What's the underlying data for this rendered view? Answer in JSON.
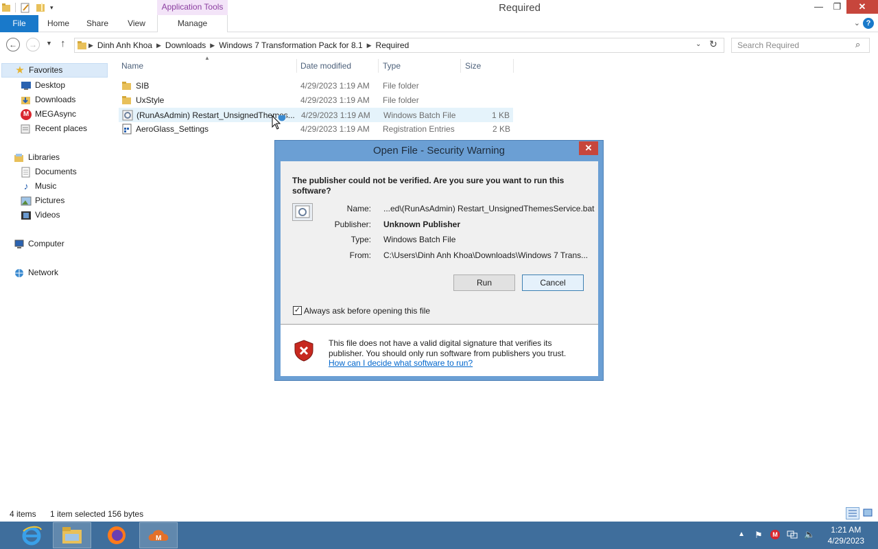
{
  "window": {
    "title": "Required",
    "contextual_tab_group": "Application Tools",
    "minimize": "—",
    "restore": "❐",
    "close": "✕"
  },
  "ribbon": {
    "tabs": [
      "File",
      "Home",
      "Share",
      "View",
      "Manage"
    ]
  },
  "address": {
    "crumbs": [
      "Dinh  Anh Khoa",
      "Downloads",
      "Windows 7 Transformation Pack for 8.1",
      "Required"
    ],
    "search_placeholder": "Search Required"
  },
  "nav": {
    "favorites_label": "Favorites",
    "favorites": [
      "Desktop",
      "Downloads",
      "MEGAsync",
      "Recent places"
    ],
    "libraries_label": "Libraries",
    "libraries": [
      "Documents",
      "Music",
      "Pictures",
      "Videos"
    ],
    "computer": "Computer",
    "network": "Network"
  },
  "columns": {
    "name": "Name",
    "date": "Date modified",
    "type": "Type",
    "size": "Size"
  },
  "files": [
    {
      "name": "SIB",
      "date": "4/29/2023 1:19 AM",
      "type": "File folder",
      "size": "",
      "icon": "folder-icon"
    },
    {
      "name": "UxStyle",
      "date": "4/29/2023 1:19 AM",
      "type": "File folder",
      "size": "",
      "icon": "folder-icon"
    },
    {
      "name": "(RunAsAdmin) Restart_UnsignedThemes...",
      "date": "4/29/2023 1:19 AM",
      "type": "Windows Batch File",
      "size": "1 KB",
      "icon": "batch-file-icon"
    },
    {
      "name": "AeroGlass_Settings",
      "date": "4/29/2023 1:19 AM",
      "type": "Registration Entries",
      "size": "2 KB",
      "icon": "registry-file-icon"
    }
  ],
  "status": {
    "count": "4 items",
    "selection": "1 item selected  156 bytes"
  },
  "dialog": {
    "title": "Open File - Security Warning",
    "question": "The publisher could not be verified.  Are you sure you want to run this software?",
    "name_label": "Name:",
    "name_value": "...ed\\(RunAsAdmin) Restart_UnsignedThemesService.bat",
    "publisher_label": "Publisher:",
    "publisher_value": "Unknown Publisher",
    "type_label": "Type:",
    "type_value": "Windows Batch File",
    "from_label": "From:",
    "from_value": "C:\\Users\\Dinh  Anh Khoa\\Downloads\\Windows 7 Trans...",
    "run_button": "Run",
    "cancel_button": "Cancel",
    "always_ask": "Always ask before opening this file",
    "always_ask_checked": true,
    "warning_text": "This file does not have a valid digital signature that verifies its publisher.  You should only run software from publishers you trust.",
    "help_link": "How can I decide what software to run?"
  },
  "taskbar": {
    "time": "1:21 AM",
    "date": "4/29/2023"
  },
  "colors": {
    "accent": "#1979ca",
    "taskbar": "#3f6e9c",
    "dialog_frame": "#6b9fd4",
    "close_red": "#c7463c",
    "selection": "#e5f3fb"
  }
}
